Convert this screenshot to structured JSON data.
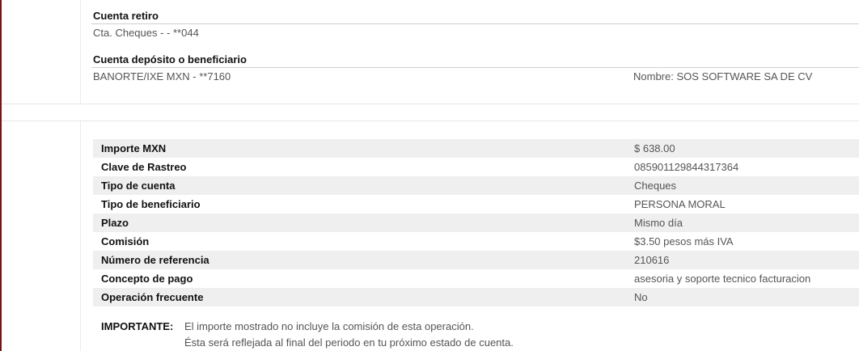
{
  "withdrawal": {
    "title": "Cuenta retiro",
    "account": "Cta. Cheques - - **044"
  },
  "deposit": {
    "title": "Cuenta depósito o beneficiario",
    "account": "BANORTE/IXE  MXN - **7160",
    "name": "Nombre: SOS SOFTWARE SA DE CV"
  },
  "details": [
    {
      "label": "Importe  MXN",
      "value": "$ 638.00"
    },
    {
      "label": "Clave de Rastreo",
      "value": "085901129844317364"
    },
    {
      "label": "Tipo de cuenta",
      "value": "Cheques"
    },
    {
      "label": "Tipo de beneficiario",
      "value": "PERSONA MORAL"
    },
    {
      "label": "Plazo",
      "value": "Mismo día"
    },
    {
      "label": "Comisión",
      "value": "$3.50 pesos más IVA"
    },
    {
      "label": "Número de referencia",
      "value": "210616"
    },
    {
      "label": "Concepto de pago",
      "value": "asesoria y soporte tecnico facturacion"
    },
    {
      "label": "Operación frecuente",
      "value": "No"
    }
  ],
  "notice": {
    "label": "IMPORTANTE:",
    "line1": "El importe mostrado no incluye la comisión de esta operación.",
    "line2": "Ésta será reflejada al final del periodo en tu próximo estado de cuenta."
  }
}
